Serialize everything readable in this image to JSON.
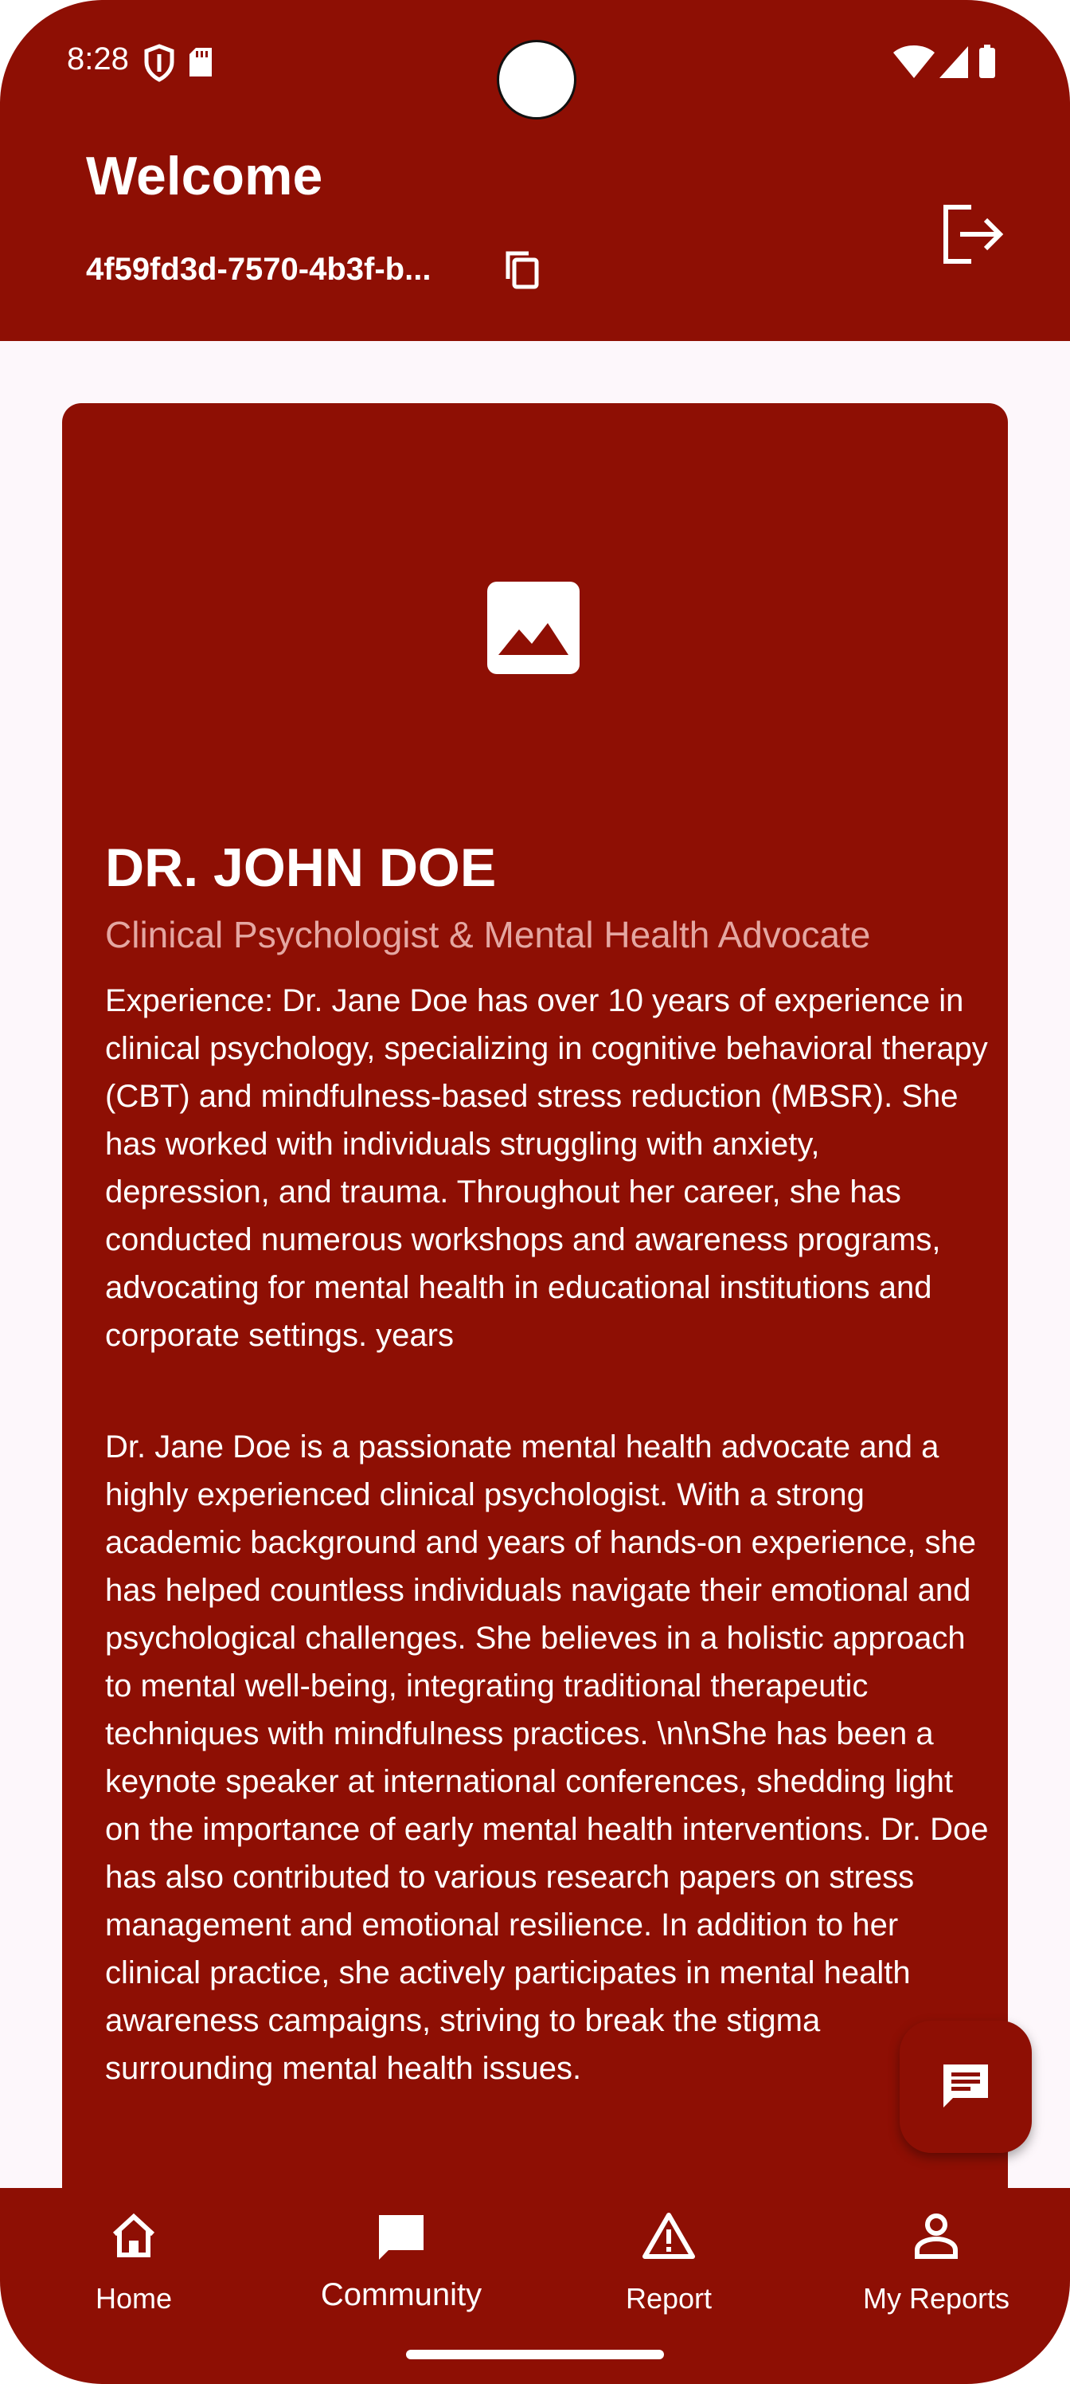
{
  "status_bar": {
    "time": "8:28"
  },
  "header": {
    "title": "Welcome",
    "user_id": "4f59fd3d-7570-4b3f-b..."
  },
  "profile": {
    "name": "DR. JOHN DOE",
    "role": "Clinical Psychologist & Mental Health Advocate",
    "experience": "Experience: Dr. Jane Doe has over 10 years of experience in clinical psychology, specializing in cognitive behavioral therapy (CBT) and mindfulness-based stress reduction (MBSR). She has worked with individuals struggling with anxiety, depression, and trauma. Throughout her career, she has conducted numerous workshops and awareness programs, advocating for mental health in educational institutions and corporate settings. years",
    "bio": "Dr. Jane Doe is a passionate mental health advocate and a highly experienced clinical psychologist. With a strong academic background and years of hands-on experience, she has helped countless individuals navigate their emotional and psychological challenges. She believes in a holistic approach to mental well-being, integrating traditional therapeutic techniques with mindfulness practices. \\n\\nShe has been a keynote speaker at international conferences, shedding light on the importance of early mental health interventions. Dr. Doe has also contributed to various research papers on stress management and emotional resilience. In addition to her clinical practice, she actively participates in mental health awareness campaigns, striving to break the stigma surrounding mental health issues."
  },
  "nav": {
    "items": [
      {
        "label": "Home",
        "icon": "home-icon"
      },
      {
        "label": "Community",
        "icon": "chat-icon"
      },
      {
        "label": "Report",
        "icon": "warning-icon"
      },
      {
        "label": "My Reports",
        "icon": "person-icon"
      }
    ],
    "active_index": 1
  },
  "colors": {
    "primary": "#8e0f04",
    "background": "#fdf7fb",
    "subtitle": "#e4a7a2",
    "on_primary": "#ffffff"
  }
}
